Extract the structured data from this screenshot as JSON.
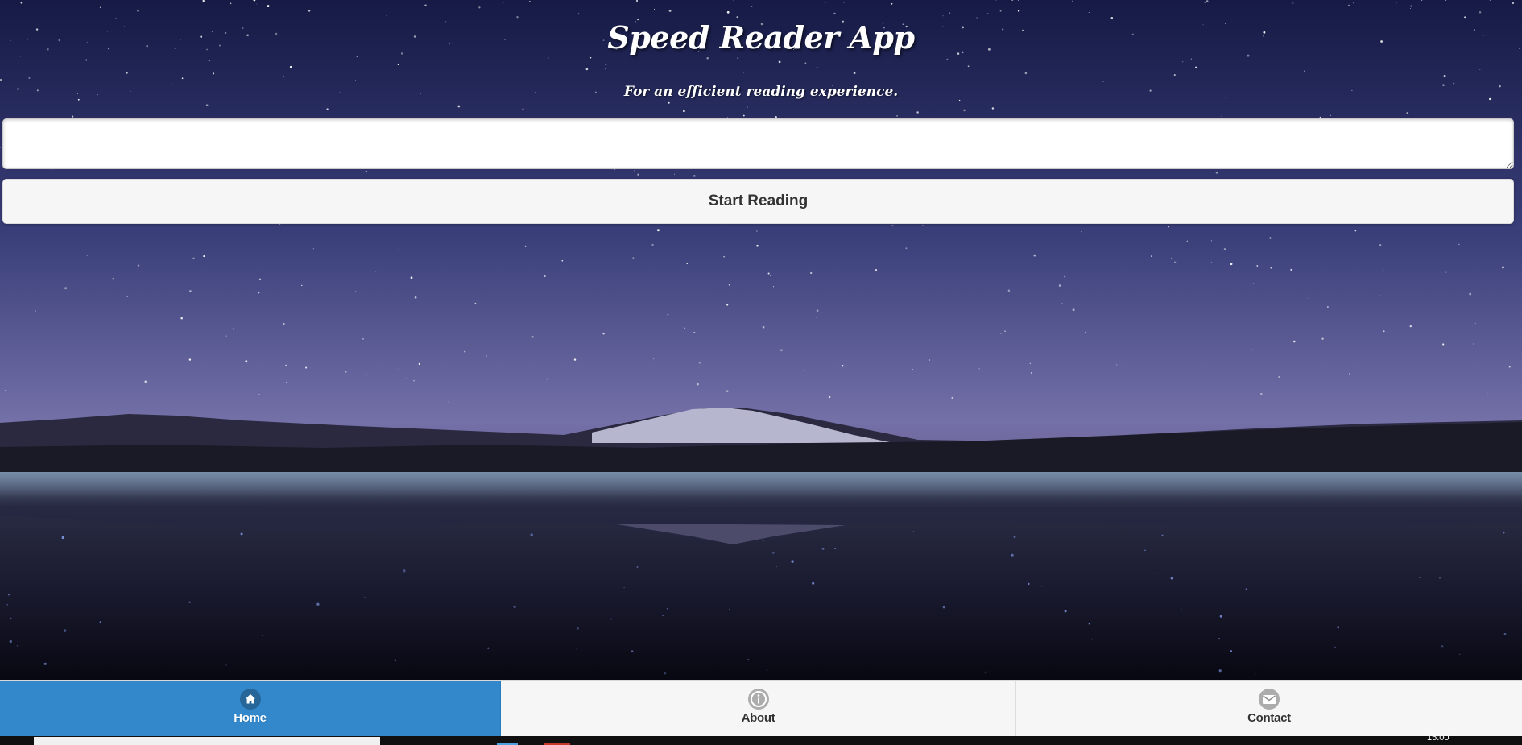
{
  "header": {
    "title": "Speed Reader App",
    "subtitle": "For an efficient reading experience."
  },
  "reader": {
    "text_value": "",
    "start_label": "Start Reading"
  },
  "navbar": {
    "items": [
      {
        "label": "Home",
        "icon": "home-icon",
        "active": true
      },
      {
        "label": "About",
        "icon": "info-icon",
        "active": false
      },
      {
        "label": "Contact",
        "icon": "mail-icon",
        "active": false
      }
    ]
  },
  "taskbar": {
    "clock": "15:00"
  },
  "colors": {
    "accent": "#3388cc",
    "nav_background": "#f6f6f6",
    "button_background": "#f6f6f6",
    "sky_top": "#1a1d4a",
    "sky_horizon": "#7a74b0"
  }
}
